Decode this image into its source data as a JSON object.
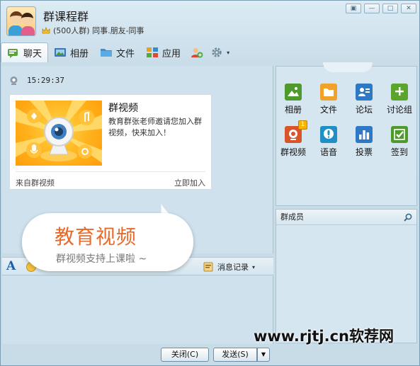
{
  "window": {
    "title": "群课程群",
    "subtitle": "(500人群) 同事.朋友-同事",
    "controls": [
      "▣",
      "—",
      "□",
      "✕"
    ]
  },
  "tabs": [
    {
      "label": "聊天",
      "icon": "chat-icon"
    },
    {
      "label": "相册",
      "icon": "photo-icon"
    },
    {
      "label": "文件",
      "icon": "folder-icon"
    },
    {
      "label": "应用",
      "icon": "apps-icon"
    }
  ],
  "chat": {
    "time": "15:29:37",
    "card": {
      "title": "群视频",
      "description": "教育群张老师邀请您加入群视频，快来加入！",
      "source": "来自群视频",
      "join": "立即加入"
    },
    "bubble": {
      "headline": "教育视频",
      "caption": "群视频支持上课啦 ~"
    }
  },
  "toolbar": {
    "font_glyph": "A",
    "history_label": "消息记录"
  },
  "buttons": {
    "close": "关闭(C)",
    "send": "发送(S)",
    "arrow": "▼"
  },
  "apps": [
    {
      "label": "相册",
      "icon": "photo-app-icon",
      "color": "#4f9a2d"
    },
    {
      "label": "文件",
      "icon": "folder-app-icon",
      "color": "#f0a22a"
    },
    {
      "label": "论坛",
      "icon": "forum-app-icon",
      "color": "#2f78c4"
    },
    {
      "label": "讨论组",
      "icon": "discussion-app-icon",
      "color": "#5ca52d"
    },
    {
      "label": "群视频",
      "icon": "group-video-app-icon",
      "color": "#d9532b",
      "badge": "1"
    },
    {
      "label": "语音",
      "icon": "voice-app-icon",
      "color": "#1f8fc4"
    },
    {
      "label": "投票",
      "icon": "vote-app-icon",
      "color": "#2f78c4"
    },
    {
      "label": "签到",
      "icon": "checkin-app-icon",
      "color": "#4f9a2d"
    }
  ],
  "members": {
    "header": "群成员"
  },
  "watermark": "www.rjtj.cn软荐网"
}
